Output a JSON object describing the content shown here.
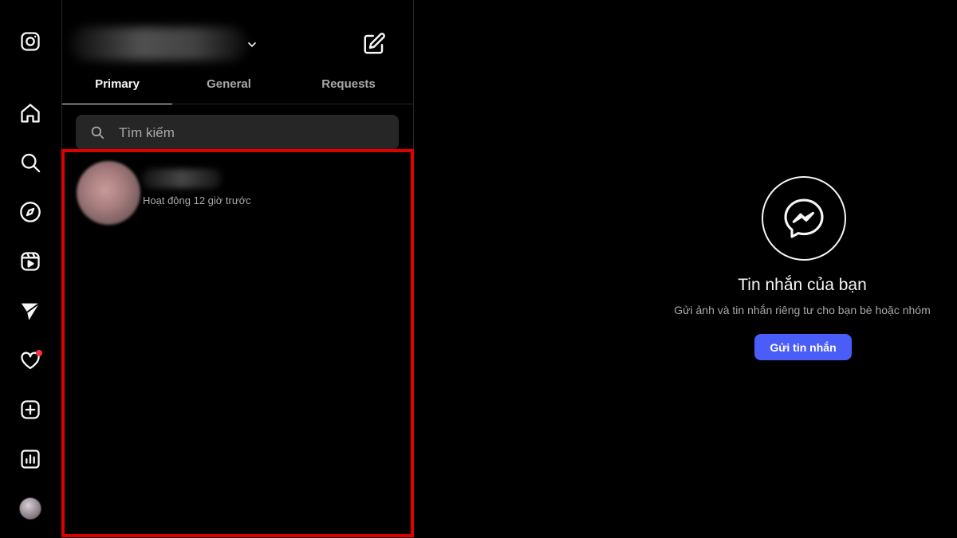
{
  "rail": {
    "items": [
      {
        "icon": "instagram-logo-icon"
      },
      {
        "icon": "home-icon"
      },
      {
        "icon": "search-icon"
      },
      {
        "icon": "explore-compass-icon"
      },
      {
        "icon": "reels-icon"
      },
      {
        "icon": "messages-send-icon"
      },
      {
        "icon": "notifications-heart-icon"
      },
      {
        "icon": "create-plus-icon"
      },
      {
        "icon": "dashboard-chart-icon"
      },
      {
        "icon": "profile-avatar"
      }
    ],
    "notification_dot_color": "#ff3040"
  },
  "inbox": {
    "tabs": [
      {
        "label": "Primary",
        "active": true
      },
      {
        "label": "General",
        "active": false
      },
      {
        "label": "Requests",
        "active": false
      }
    ],
    "search": {
      "placeholder": "Tìm kiếm",
      "value": ""
    },
    "conversations": [
      {
        "status": "Hoạt động 12 giờ trước"
      }
    ],
    "highlight_color": "#e00000"
  },
  "empty_state": {
    "title": "Tin nhắn của bạn",
    "subtitle": "Gửi ảnh và tin nhắn riêng tư cho bạn bè hoặc nhóm",
    "button_label": "Gửi tin nhắn",
    "button_color": "#4a5df9"
  }
}
